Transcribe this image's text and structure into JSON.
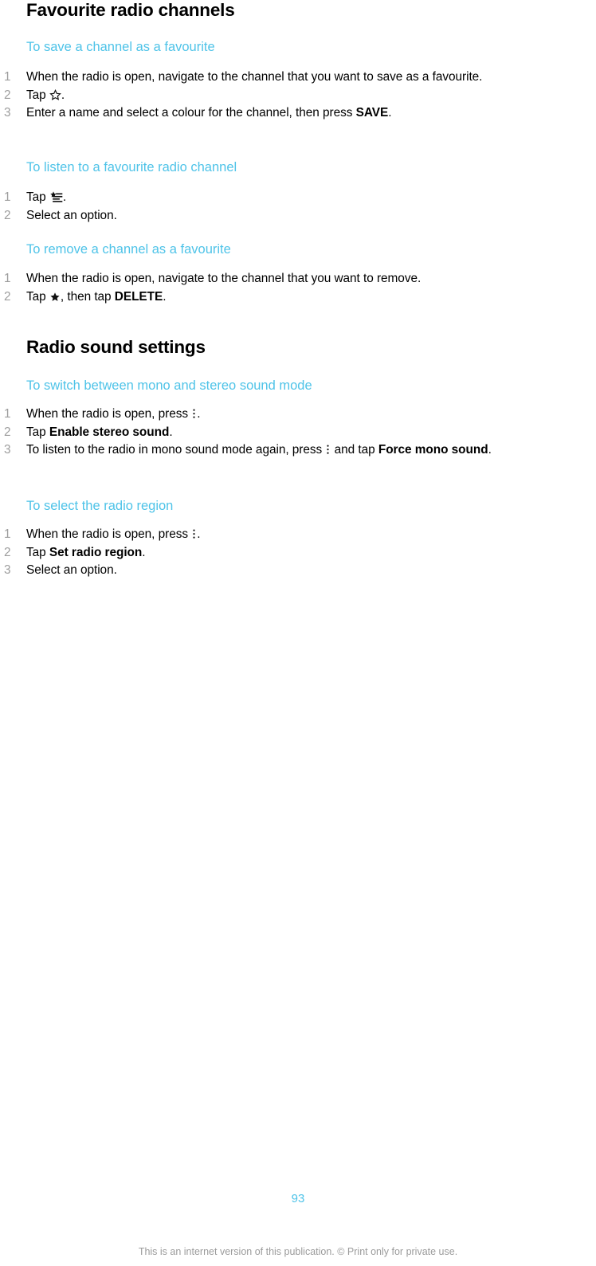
{
  "document": {
    "page_number": "93",
    "footer_disclaimer": "This is an internet version of this publication. © Print only for private use.",
    "accent_color": "#4ec3e8",
    "number_color": "#9d9d9d",
    "text_color": "#000000"
  },
  "sections": [
    {
      "title": "Favourite radio channels",
      "tasks": [
        {
          "title": "To save a channel as a favourite",
          "steps": [
            {
              "parts": [
                {
                  "type": "text",
                  "value": "When the radio is open, navigate to the channel that you want to save as a favourite."
                }
              ]
            },
            {
              "parts": [
                {
                  "type": "text",
                  "value": "Tap "
                },
                {
                  "type": "icon",
                  "value": "star-outline-icon"
                },
                {
                  "type": "text",
                  "value": "."
                }
              ]
            },
            {
              "parts": [
                {
                  "type": "text",
                  "value": "Enter a name and select a colour for the channel, then press "
                },
                {
                  "type": "bold",
                  "value": "SAVE"
                },
                {
                  "type": "text",
                  "value": "."
                }
              ]
            }
          ]
        },
        {
          "title": "To listen to a favourite radio channel",
          "steps": [
            {
              "parts": [
                {
                  "type": "text",
                  "value": "Tap "
                },
                {
                  "type": "icon",
                  "value": "favourites-list-icon"
                },
                {
                  "type": "text",
                  "value": "."
                }
              ]
            },
            {
              "parts": [
                {
                  "type": "text",
                  "value": "Select an option."
                }
              ]
            }
          ]
        },
        {
          "title": "To remove a channel as a favourite",
          "steps": [
            {
              "parts": [
                {
                  "type": "text",
                  "value": "When the radio is open, navigate to the channel that you want to remove."
                }
              ]
            },
            {
              "parts": [
                {
                  "type": "text",
                  "value": "Tap "
                },
                {
                  "type": "icon",
                  "value": "star-filled-icon"
                },
                {
                  "type": "text",
                  "value": ", then tap "
                },
                {
                  "type": "bold",
                  "value": "DELETE"
                },
                {
                  "type": "text",
                  "value": "."
                }
              ]
            }
          ]
        }
      ]
    },
    {
      "title": "Radio sound settings",
      "tasks": [
        {
          "title": "To switch between mono and stereo sound mode",
          "steps": [
            {
              "parts": [
                {
                  "type": "text",
                  "value": "When the radio is open, press "
                },
                {
                  "type": "icon",
                  "value": "overflow-menu-icon"
                },
                {
                  "type": "text",
                  "value": "."
                }
              ]
            },
            {
              "parts": [
                {
                  "type": "text",
                  "value": "Tap "
                },
                {
                  "type": "bold",
                  "value": "Enable stereo sound"
                },
                {
                  "type": "text",
                  "value": "."
                }
              ]
            },
            {
              "parts": [
                {
                  "type": "text",
                  "value": "To listen to the radio in mono sound mode again, press "
                },
                {
                  "type": "icon",
                  "value": "overflow-menu-icon"
                },
                {
                  "type": "text",
                  "value": " and tap "
                },
                {
                  "type": "bold",
                  "value": "Force mono sound"
                },
                {
                  "type": "text",
                  "value": "."
                }
              ]
            }
          ]
        },
        {
          "title": "To select the radio region",
          "steps": [
            {
              "parts": [
                {
                  "type": "text",
                  "value": "When the radio is open, press "
                },
                {
                  "type": "icon",
                  "value": "overflow-menu-icon"
                },
                {
                  "type": "text",
                  "value": "."
                }
              ]
            },
            {
              "parts": [
                {
                  "type": "text",
                  "value": "Tap "
                },
                {
                  "type": "bold",
                  "value": "Set radio region"
                },
                {
                  "type": "text",
                  "value": "."
                }
              ]
            },
            {
              "parts": [
                {
                  "type": "text",
                  "value": "Select an option."
                }
              ]
            }
          ]
        }
      ]
    }
  ]
}
